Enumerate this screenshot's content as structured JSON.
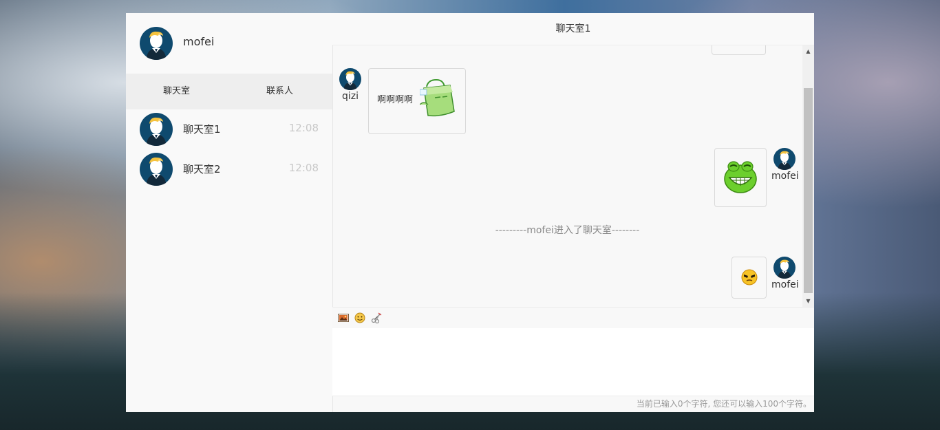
{
  "user": {
    "name": "mofei"
  },
  "tabs": {
    "chat": "聊天室",
    "contacts": "联系人"
  },
  "rooms": [
    {
      "name": "聊天室1",
      "time": "12:08"
    },
    {
      "name": "聊天室2",
      "time": "12:08"
    }
  ],
  "chat": {
    "title": "聊天室1",
    "messages": [
      {
        "sender": "qizi",
        "side": "left",
        "text": "啊啊啊啊",
        "sticker": "green-bag-sticker"
      },
      {
        "sender": "mofei",
        "side": "right",
        "sticker": "green-frog-grin-emoji"
      },
      {
        "type": "system",
        "text": "---------mofei进入了聊天室--------"
      },
      {
        "sender": "mofei",
        "side": "right",
        "sticker": "cool-face-emoji"
      }
    ]
  },
  "toolbar": {
    "icons": [
      "image-icon",
      "emoji-icon",
      "scissors-icon"
    ]
  },
  "input": {
    "value": "",
    "counter_text": "当前已输入0个字符, 您还可以输入100个字符。"
  },
  "colors": {
    "avatar_bg": "#0f4a6e",
    "accent_green": "#7ccd3a"
  }
}
